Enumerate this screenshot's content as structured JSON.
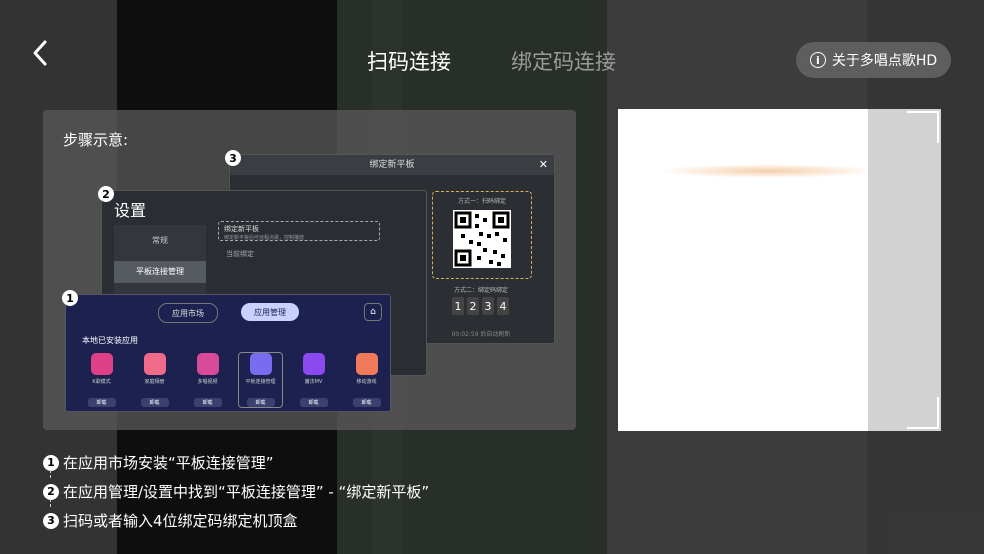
{
  "header": {
    "tabs": [
      {
        "label": "扫码连接",
        "active": true
      },
      {
        "label": "绑定码连接",
        "active": false
      }
    ],
    "about_label": "关于多唱点歌HD"
  },
  "steps_panel": {
    "title": "步骤示意:",
    "card3": {
      "title": "绑定新平板",
      "qr_label": "方式一：扫码绑定",
      "code_label": "方式二：绑定码绑定",
      "digits": [
        "1",
        "2",
        "3",
        "4"
      ],
      "timer": "00:02:59 后自动刷新"
    },
    "card2": {
      "title": "设置",
      "menu_general": "常规",
      "menu_tablet": "平板连接管理",
      "item_title": "绑定新平板",
      "item_desc": "绑定新平板后可远程点歌，控制播放",
      "current": "当前绑定"
    },
    "card1": {
      "seg_market": "应用市场",
      "seg_manage": "应用管理",
      "installed_title": "本地已安装应用",
      "apps": [
        {
          "name": "K歌模式",
          "btn": "卸载",
          "color": "#e0408a"
        },
        {
          "name": "家庭相册",
          "btn": "卸载",
          "color": "#f06a8a"
        },
        {
          "name": "多唱视频",
          "btn": "卸载",
          "color": "#d84a9a"
        },
        {
          "name": "平板连接管理",
          "btn": "卸载",
          "color": "#7a6cf0"
        },
        {
          "name": "魔法MV",
          "btn": "卸载",
          "color": "#8a4af0"
        },
        {
          "name": "移动游戏",
          "btn": "卸载",
          "color": "#f07a5a"
        }
      ]
    },
    "step_numbers": [
      "1",
      "2",
      "3"
    ]
  },
  "instructions": [
    {
      "num": "1",
      "text": "在应用市场安装“平板连接管理”"
    },
    {
      "num": "2",
      "text": "在应用管理/设置中找到“平板连接管理” - “绑定新平板”"
    },
    {
      "num": "3",
      "text": "扫码或者输入4位绑定码绑定机顶盒"
    }
  ]
}
